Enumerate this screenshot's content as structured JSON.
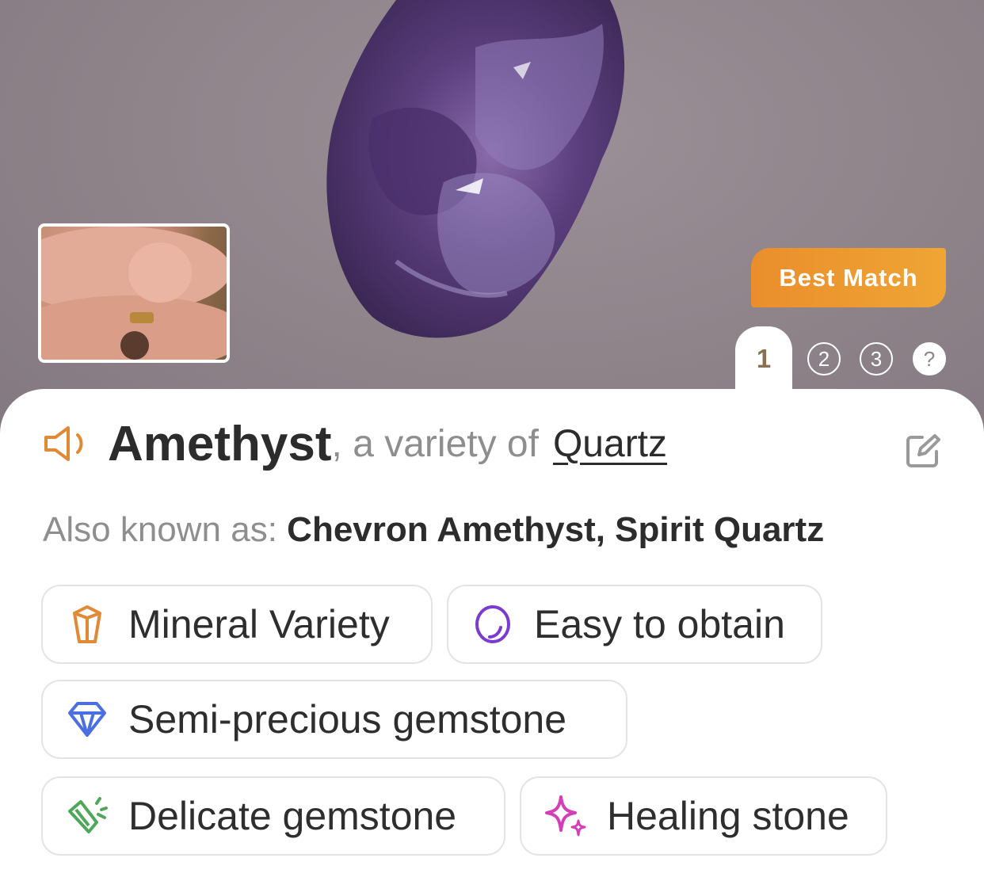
{
  "result": {
    "best_match_label": "Best Match",
    "pages": [
      "1",
      "2",
      "3",
      "?"
    ],
    "active_page": "1"
  },
  "title": {
    "name": "Amethyst",
    "connector": ", a variety of",
    "parent": "Quartz"
  },
  "aka": {
    "label": "Also known as:",
    "values": "Chevron Amethyst, Spirit Quartz"
  },
  "tags": [
    {
      "label": "Mineral Variety",
      "icon": "crystal-icon",
      "color": "#e08a35"
    },
    {
      "label": "Easy to obtain",
      "icon": "oval-stone-icon",
      "color": "#7c3bd0"
    },
    {
      "label": "Semi-precious gemstone",
      "icon": "diamond-icon",
      "color": "#4a6fe0"
    },
    {
      "label": "Delicate gemstone",
      "icon": "broken-crystal-icon",
      "color": "#4fa85a"
    },
    {
      "label": "Healing stone",
      "icon": "sparkle-icon",
      "color": "#d43fb8"
    }
  ],
  "colors": {
    "accent": "#e08a35",
    "badge": "#ea8e2c",
    "text": "#2c2c2c",
    "muted": "#8e8e8e"
  }
}
